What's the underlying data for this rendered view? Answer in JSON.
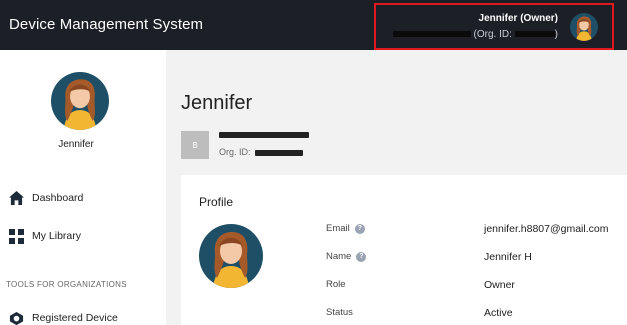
{
  "header": {
    "app_title": "Device Management System",
    "user_name": "Jennifer (Owner)",
    "org_label_prefix": "(Org. ID:",
    "org_label_suffix": ")"
  },
  "sidebar": {
    "user_name": "Jennifer",
    "items": [
      {
        "label": "Dashboard",
        "icon": "home-icon"
      },
      {
        "label": "My Library",
        "icon": "grid-icon"
      }
    ],
    "section_label": "TOOLS FOR ORGANIZATIONS",
    "org_items": [
      {
        "label": "Registered Device",
        "icon": "device-icon"
      }
    ]
  },
  "main": {
    "title": "Jennifer",
    "org_badge": "B",
    "org_id_label": "Org. ID:",
    "profile": {
      "title": "Profile",
      "fields": [
        {
          "label": "Email",
          "value": "jennifer.h8807@gmail.com",
          "help": true
        },
        {
          "label": "Name",
          "value": "Jennifer H",
          "help": true
        },
        {
          "label": "Role",
          "value": "Owner",
          "help": false
        },
        {
          "label": "Status",
          "value": "Active",
          "help": false
        }
      ]
    }
  },
  "colors": {
    "topbar": "#1c1f26",
    "highlight_border": "#e0181f",
    "avatar_bg": "#1f4f66",
    "avatar_shirt": "#f2b632"
  }
}
